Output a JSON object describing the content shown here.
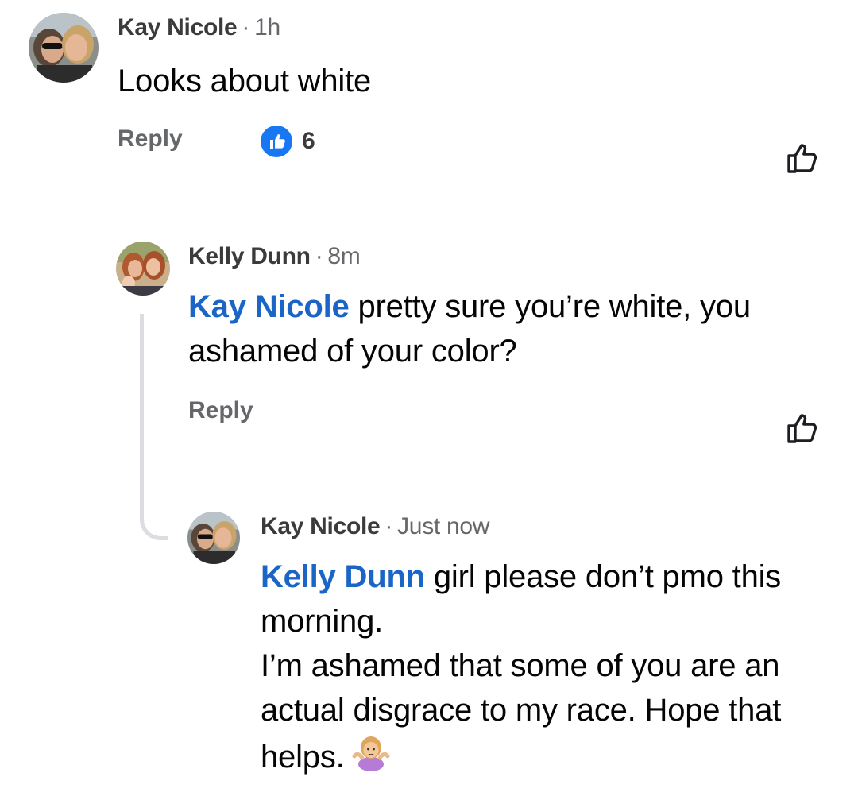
{
  "comments": [
    {
      "author": "Kay Nicole",
      "separator": "·",
      "time": "1h",
      "text": "Looks about white",
      "reply_label": "Reply",
      "reaction_count": "6",
      "reaction_icon": "like-reaction-icon",
      "like_icon": "thumbs-up-outline-icon"
    },
    {
      "author": "Kelly Dunn",
      "separator": "·",
      "time": "8m",
      "mention": "Kay Nicole",
      "text": " pretty sure you’re white, you ashamed of your color?",
      "reply_label": "Reply",
      "like_icon": "thumbs-up-outline-icon"
    },
    {
      "author": "Kay Nicole",
      "separator": "·",
      "time": "Just now",
      "mention": "Kelly Dunn",
      "text_line1": " girl please don’t pmo this morning.",
      "text_line2": "I’m ashamed that some of you are an actual disgrace to my race. Hope that helps.",
      "emoji": "person-shrugging-emoji"
    }
  ],
  "colors": {
    "mention": "#1b65c7",
    "reaction_blue": "#1877f2",
    "meta_gray": "#65676b",
    "thread_line": "#dcdde1"
  }
}
